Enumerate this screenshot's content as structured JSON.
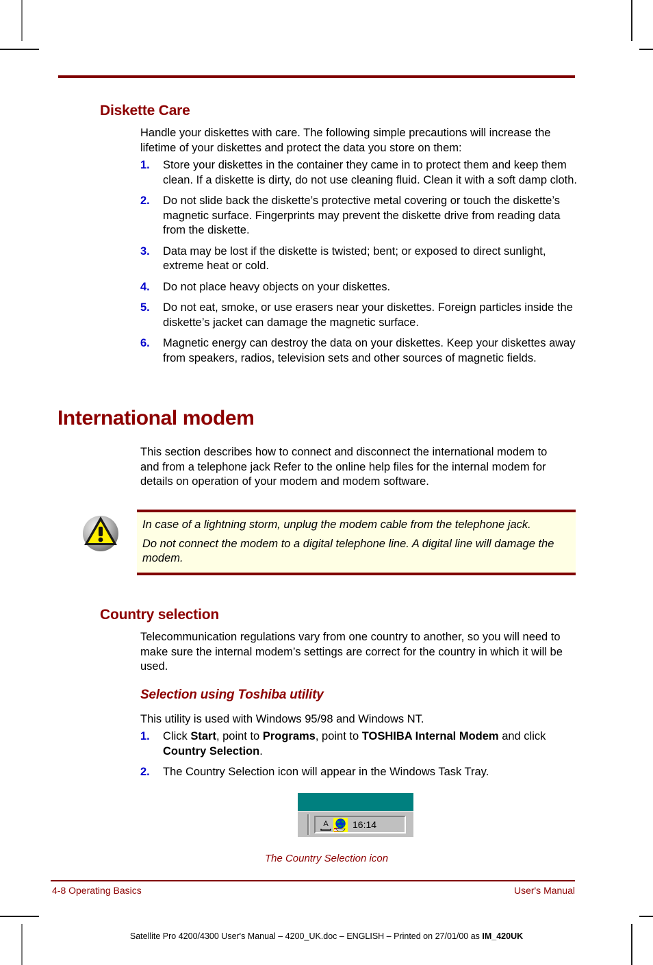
{
  "header": {
    "rule_color": "#800000"
  },
  "sections": {
    "diskette_care": {
      "heading": "Diskette Care",
      "intro": "Handle your diskettes with care. The following simple precautions will increase the lifetime of your diskettes and protect the data you store on them:",
      "items": [
        {
          "marker": "1.",
          "text": "Store your diskettes in the container they came in to protect them and keep them clean. If a diskette is dirty, do not use cleaning fluid. Clean it with a soft damp cloth."
        },
        {
          "marker": "2.",
          "text": "Do not slide back the diskette’s protective metal covering or touch the diskette’s magnetic surface. Fingerprints may prevent the diskette drive from reading data from the diskette."
        },
        {
          "marker": "3.",
          "text": "Data may be lost if the diskette is twisted; bent; or exposed to direct sunlight, extreme heat or cold."
        },
        {
          "marker": "4.",
          "text": "Do not place heavy objects on your diskettes."
        },
        {
          "marker": "5.",
          "text": "Do not eat, smoke, or use erasers near your diskettes. Foreign particles inside the diskette’s jacket can damage the magnetic surface."
        },
        {
          "marker": "6.",
          "text": "Magnetic energy can destroy the data on your diskettes. Keep your diskettes away from speakers, radios, television sets and other sources of magnetic fields."
        }
      ]
    },
    "international_modem": {
      "heading": "International modem",
      "intro": "This section describes how to connect and disconnect the international modem to and from a telephone jack Refer to the online help files for the internal modem for details on operation of your modem and modem software."
    },
    "caution": {
      "icon_name": "warning-triangle-icon",
      "lines": [
        "In case of a lightning storm, unplug the modem cable from the telephone jack.",
        "Do not connect the modem to a digital telephone line. A digital line will damage the modem."
      ],
      "background_color": "#FFFFE4",
      "border_color": "#800000"
    },
    "country_selection": {
      "heading": "Country selection",
      "intro": "Telecommunication regulations vary from one country to another, so you will need to make sure the internal modem’s settings are correct for the country in which it will be used.",
      "subheading": "Selection using Toshiba utility",
      "sub_intro": "This utility is used with Windows 95/98 and Windows NT.",
      "items": [
        {
          "marker": "1.",
          "parts": [
            {
              "t": "Click ",
              "b": false
            },
            {
              "t": "Start",
              "b": true
            },
            {
              "t": ", point to ",
              "b": false
            },
            {
              "t": "Programs",
              "b": true
            },
            {
              "t": ", point to ",
              "b": false
            },
            {
              "t": "TOSHIBA Internal Modem",
              "b": true
            },
            {
              "t": " and click ",
              "b": false
            },
            {
              "t": "Country Selection",
              "b": true
            },
            {
              "t": ".",
              "b": false
            }
          ]
        },
        {
          "marker": "2.",
          "parts": [
            {
              "t": "The Country Selection icon will appear in the Windows Task Tray.",
              "b": false
            }
          ]
        }
      ]
    }
  },
  "figure": {
    "tray_time": "16:14",
    "icon_a_name": "keyboard-layout-a-icon",
    "icon_globe_name": "country-selection-globe-icon",
    "caption": "The Country Selection icon",
    "teal_color": "#00807F",
    "taskbar_color": "#C0C0C0"
  },
  "footer": {
    "left": "4-8  Operating Basics",
    "right": "User's Manual",
    "print_line_plain_1": "Satellite Pro 4200/4300 User's Manual  – 4200_UK.doc – ENGLISH – Printed on 27/01/00 as ",
    "print_line_bold": "IM_420UK"
  }
}
